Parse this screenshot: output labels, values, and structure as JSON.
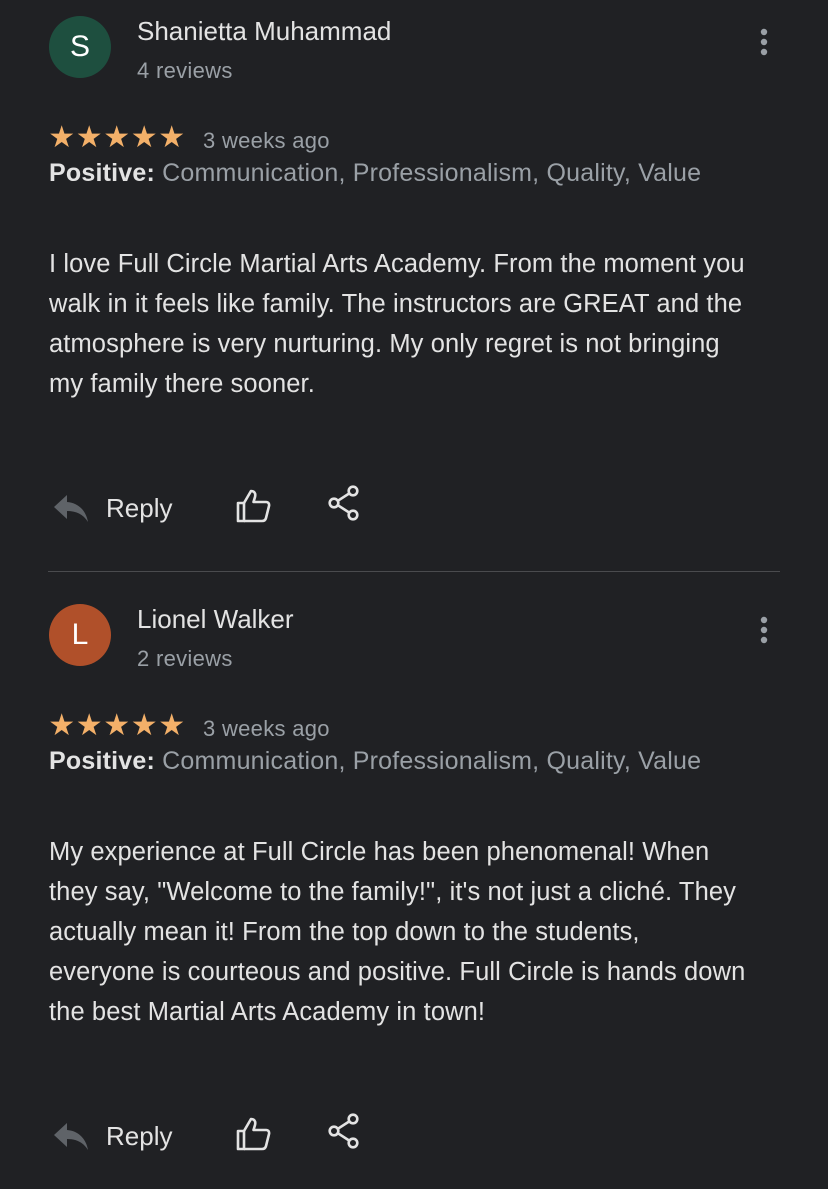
{
  "reviews": [
    {
      "avatar_letter": "S",
      "avatar_color": "#1e4f3f",
      "author": "Shanietta Muhammad",
      "review_count": "4 reviews",
      "rating": 5,
      "time_ago": "3 weeks ago",
      "positive_label": "Positive:",
      "positive_values": "Communication, Professionalism, Quality, Value",
      "text": "I love Full Circle Martial Arts Academy. From the moment you walk in it feels like family. The instructors are GREAT and the atmosphere is very nurturing. My only regret is not bringing my family there sooner.",
      "reply_label": "Reply",
      "icons": {
        "more": "more-vert-icon",
        "reply": "reply-arrow-icon",
        "like": "thumbs-up-icon",
        "share": "share-icon"
      }
    },
    {
      "avatar_letter": "L",
      "avatar_color": "#b0502a",
      "author": "Lionel Walker",
      "review_count": "2 reviews",
      "rating": 5,
      "time_ago": "3 weeks ago",
      "positive_label": "Positive:",
      "positive_values": "Communication, Professionalism, Quality, Value",
      "text": "My experience at Full Circle has been phenomenal! When they say, \"Welcome to the family!\", it's not just a cliché. They actually mean it! From the top down to the students, everyone is courteous and positive. Full Circle is hands down the best Martial Arts Academy in town!",
      "reply_label": "Reply",
      "icons": {
        "more": "more-vert-icon",
        "reply": "reply-arrow-icon",
        "like": "thumbs-up-icon",
        "share": "share-icon"
      }
    }
  ],
  "colors": {
    "background": "#202124",
    "star": "#f3b069",
    "primary_text": "#e3e3e3",
    "secondary_text": "#9aa0a6",
    "divider": "#4a4b4e"
  }
}
